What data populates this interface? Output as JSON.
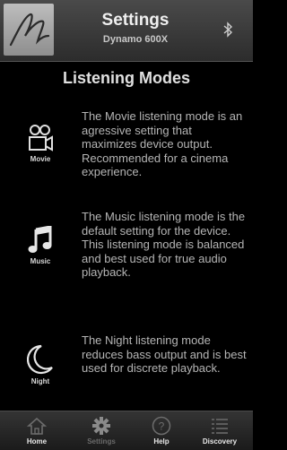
{
  "header": {
    "title": "Settings",
    "subtitle": "Dynamo 600X",
    "logo_icon": "signature-logo",
    "right_icon": "bluetooth-icon"
  },
  "page": {
    "heading": "Listening Modes"
  },
  "modes": [
    {
      "icon": "movie-camera-icon",
      "label": "Movie",
      "description": "The Movie listening mode is an agressive setting that maximizes device output. Recommended for a cinema experience."
    },
    {
      "icon": "music-note-icon",
      "label": "Music",
      "description": "The Music listening mode is the default setting for the device. This listening mode is balanced and best used for true audio playback."
    },
    {
      "icon": "crescent-moon-icon",
      "label": "Night",
      "description": "The Night listening mode reduces bass output and is best used for discrete playback."
    }
  ],
  "tabbar": {
    "tabs": [
      {
        "label": "Home",
        "icon": "home-icon",
        "active": true
      },
      {
        "label": "Settings",
        "icon": "gear-icon",
        "active": false
      },
      {
        "label": "Help",
        "icon": "help-icon",
        "active": true
      },
      {
        "label": "Discovery",
        "icon": "list-icon",
        "active": true
      }
    ]
  },
  "colors": {
    "background": "#000000",
    "header": "#3a3a3a",
    "text": "#b5b5b5"
  }
}
